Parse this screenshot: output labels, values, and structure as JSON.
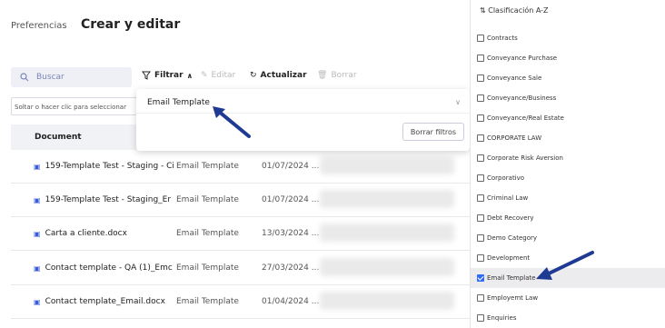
{
  "header": {
    "breadcrumb": "Preferencias",
    "title": "Crear y editar"
  },
  "toolbar": {
    "search_placeholder": "Buscar",
    "filter_label": "Filtrar",
    "edit_label": "Editar",
    "refresh_label": "Actualizar",
    "delete_label": "Borrar"
  },
  "drop_zone": "Soltar o hacer clic para seleccionar",
  "table": {
    "column_document": "Document",
    "rows": [
      {
        "document": "159-Template Test - Staging - Ci",
        "category": "Email Template",
        "date": "01/07/2024 ..."
      },
      {
        "document": "159-Template Test - Staging_Er",
        "category": "Email Template",
        "date": "01/07/2024 ..."
      },
      {
        "document": "Carta a cliente.docx",
        "category": "Email Template",
        "date": "13/03/2024 ..."
      },
      {
        "document": "Contact template - QA (1)_Emc",
        "category": "Email Template",
        "date": "27/03/2024 ..."
      },
      {
        "document": "Contact template_Email.docx",
        "category": "Email Template",
        "date": "01/04/2024 ..."
      }
    ]
  },
  "filter_panel": {
    "selected": "Email Template",
    "clear_label": "Borrar filtros"
  },
  "category_panel": {
    "sort_label": "Clasificación A-Z",
    "options": [
      {
        "label": "Contracts",
        "checked": false
      },
      {
        "label": "Conveyance Purchase",
        "checked": false
      },
      {
        "label": "Conveyance Sale",
        "checked": false
      },
      {
        "label": "Conveyance/Business",
        "checked": false
      },
      {
        "label": "Conveyance/Real Estate",
        "checked": false
      },
      {
        "label": "CORPORATE LAW",
        "checked": false
      },
      {
        "label": "Corporate Risk Aversion",
        "checked": false
      },
      {
        "label": "Corporativo",
        "checked": false
      },
      {
        "label": "Criminal Law",
        "checked": false
      },
      {
        "label": "Debt Recovery",
        "checked": false
      },
      {
        "label": "Demo Category",
        "checked": false
      },
      {
        "label": "Development",
        "checked": false
      },
      {
        "label": "Email Template",
        "checked": true
      },
      {
        "label": "Employemt Law",
        "checked": false
      },
      {
        "label": "Enquiries",
        "checked": false
      }
    ]
  },
  "colors": {
    "accent": "#2f6bff",
    "annotation_arrow": "#1f3a93"
  }
}
